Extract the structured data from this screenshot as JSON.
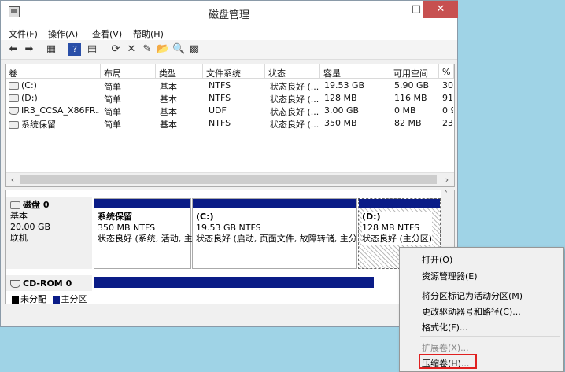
{
  "window": {
    "title": "磁盘管理",
    "min": "–",
    "max": "□",
    "close": "✕"
  },
  "menu": [
    "文件(F)",
    "操作(A)",
    "查看(V)",
    "帮助(H)"
  ],
  "toolbar_icons": [
    "back-arrow-icon",
    "forward-arrow-icon",
    "properties-icon",
    "help-icon",
    "view-icon",
    "refresh-icon",
    "delete-icon",
    "properties-sheet-icon",
    "open-folder-icon",
    "search-icon",
    "grid-icon"
  ],
  "volumes": {
    "headers": [
      "卷",
      "布局",
      "类型",
      "文件系统",
      "状态",
      "容量",
      "可用空间",
      "% "
    ],
    "rows": [
      [
        "(C:)",
        "简单",
        "基本",
        "NTFS",
        "状态良好 (...",
        "19.53 GB",
        "5.90 GB",
        "30"
      ],
      [
        "(D:)",
        "简单",
        "基本",
        "NTFS",
        "状态良好 (...",
        "128 MB",
        "116 MB",
        "91"
      ],
      [
        "IR3_CCSA_X86FR...",
        "简单",
        "基本",
        "UDF",
        "状态良好 (...",
        "3.00 GB",
        "0 MB",
        "0 9"
      ],
      [
        "系统保留",
        "简单",
        "基本",
        "NTFS",
        "状态良好 (...",
        "350 MB",
        "82 MB",
        "23"
      ]
    ]
  },
  "disk0": {
    "name": "磁盘 0",
    "type": "基本",
    "size": "20.00 GB",
    "state": "联机",
    "partitions": [
      {
        "name": "系统保留",
        "size": "350 MB NTFS",
        "status": "状态良好 (系统, 活动, 主"
      },
      {
        "name": "(C:)",
        "size": "19.53 GB NTFS",
        "status": "状态良好 (启动, 页面文件, 故障转储, 主分"
      },
      {
        "name": "(D:)",
        "size": "128 MB NTFS",
        "status": "状态良好 (主分区)"
      }
    ]
  },
  "cdrom": {
    "name": "CD-ROM 0"
  },
  "legend": {
    "unallocated": "未分配",
    "primary": "主分区"
  },
  "context_menu": {
    "open": "打开(O)",
    "explorer": "资源管理器(E)",
    "mark_active": "将分区标记为活动分区(M)",
    "change_letter": "更改驱动器号和路径(C)...",
    "format": "格式化(F)...",
    "extend": "扩展卷(X)...",
    "shrink": "压缩卷(H)..."
  },
  "colors": {
    "partition_bar": "#0a1c87",
    "highlight": "#e02020",
    "close": "#c75050"
  }
}
